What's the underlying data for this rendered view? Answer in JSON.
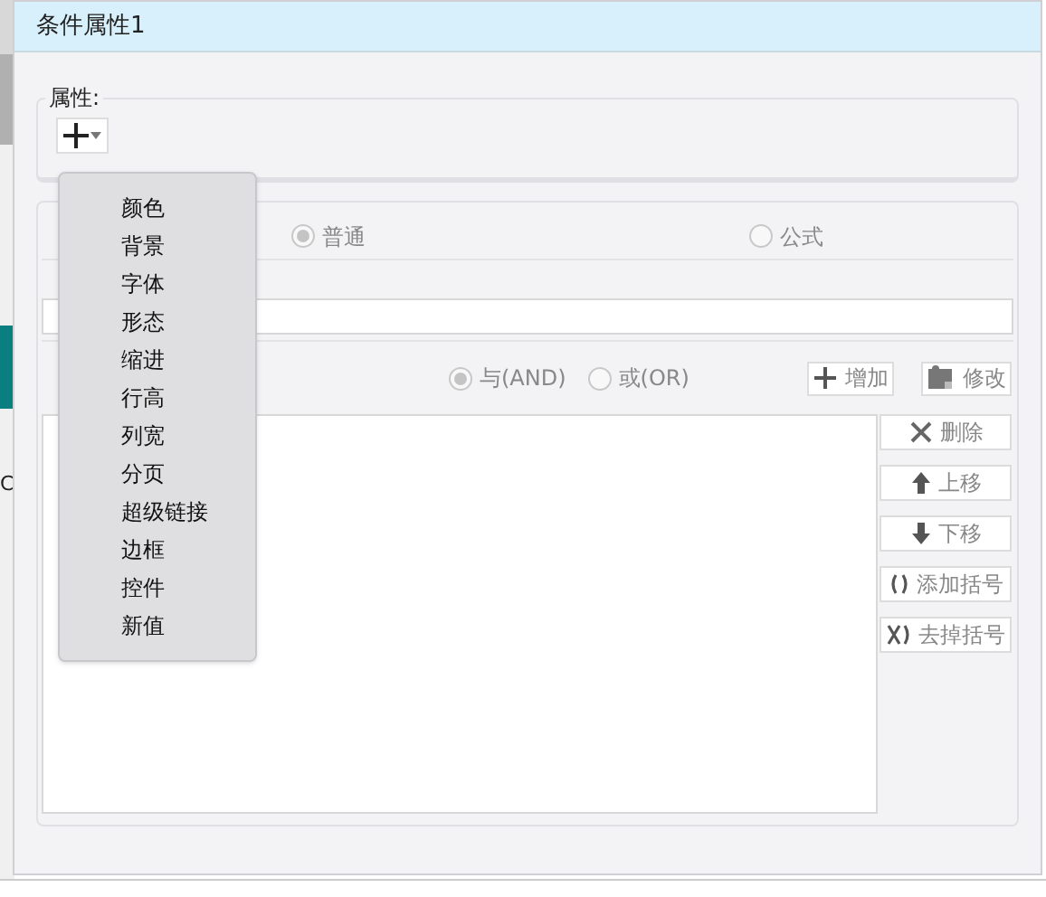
{
  "background": {
    "text": "C"
  },
  "window": {
    "title": "条件属性1"
  },
  "attributes": {
    "legend": "属性:",
    "add_menu": {
      "expanded": true,
      "items": [
        "颜色",
        "背景",
        "字体",
        "形态",
        "缩进",
        "行高",
        "列宽",
        "分页",
        "超级链接",
        "边框",
        "控件",
        "新值"
      ]
    }
  },
  "condition": {
    "type_options": [
      {
        "label": "普通",
        "selected": true
      },
      {
        "label": "公式",
        "selected": false
      }
    ],
    "join_options": [
      {
        "label": "与(AND)",
        "selected": true
      },
      {
        "label": "或(OR)",
        "selected": false
      }
    ],
    "top_buttons": [
      {
        "kind": "plus",
        "label": "增加"
      },
      {
        "kind": "edit",
        "label": "修改"
      }
    ],
    "side_buttons": [
      {
        "kind": "delete",
        "label": "删除"
      },
      {
        "kind": "up",
        "label": "上移"
      },
      {
        "kind": "down",
        "label": "下移"
      },
      {
        "kind": "add-brackets",
        "label": "添加括号"
      },
      {
        "kind": "remove-brackets",
        "label": "去掉括号"
      }
    ]
  }
}
